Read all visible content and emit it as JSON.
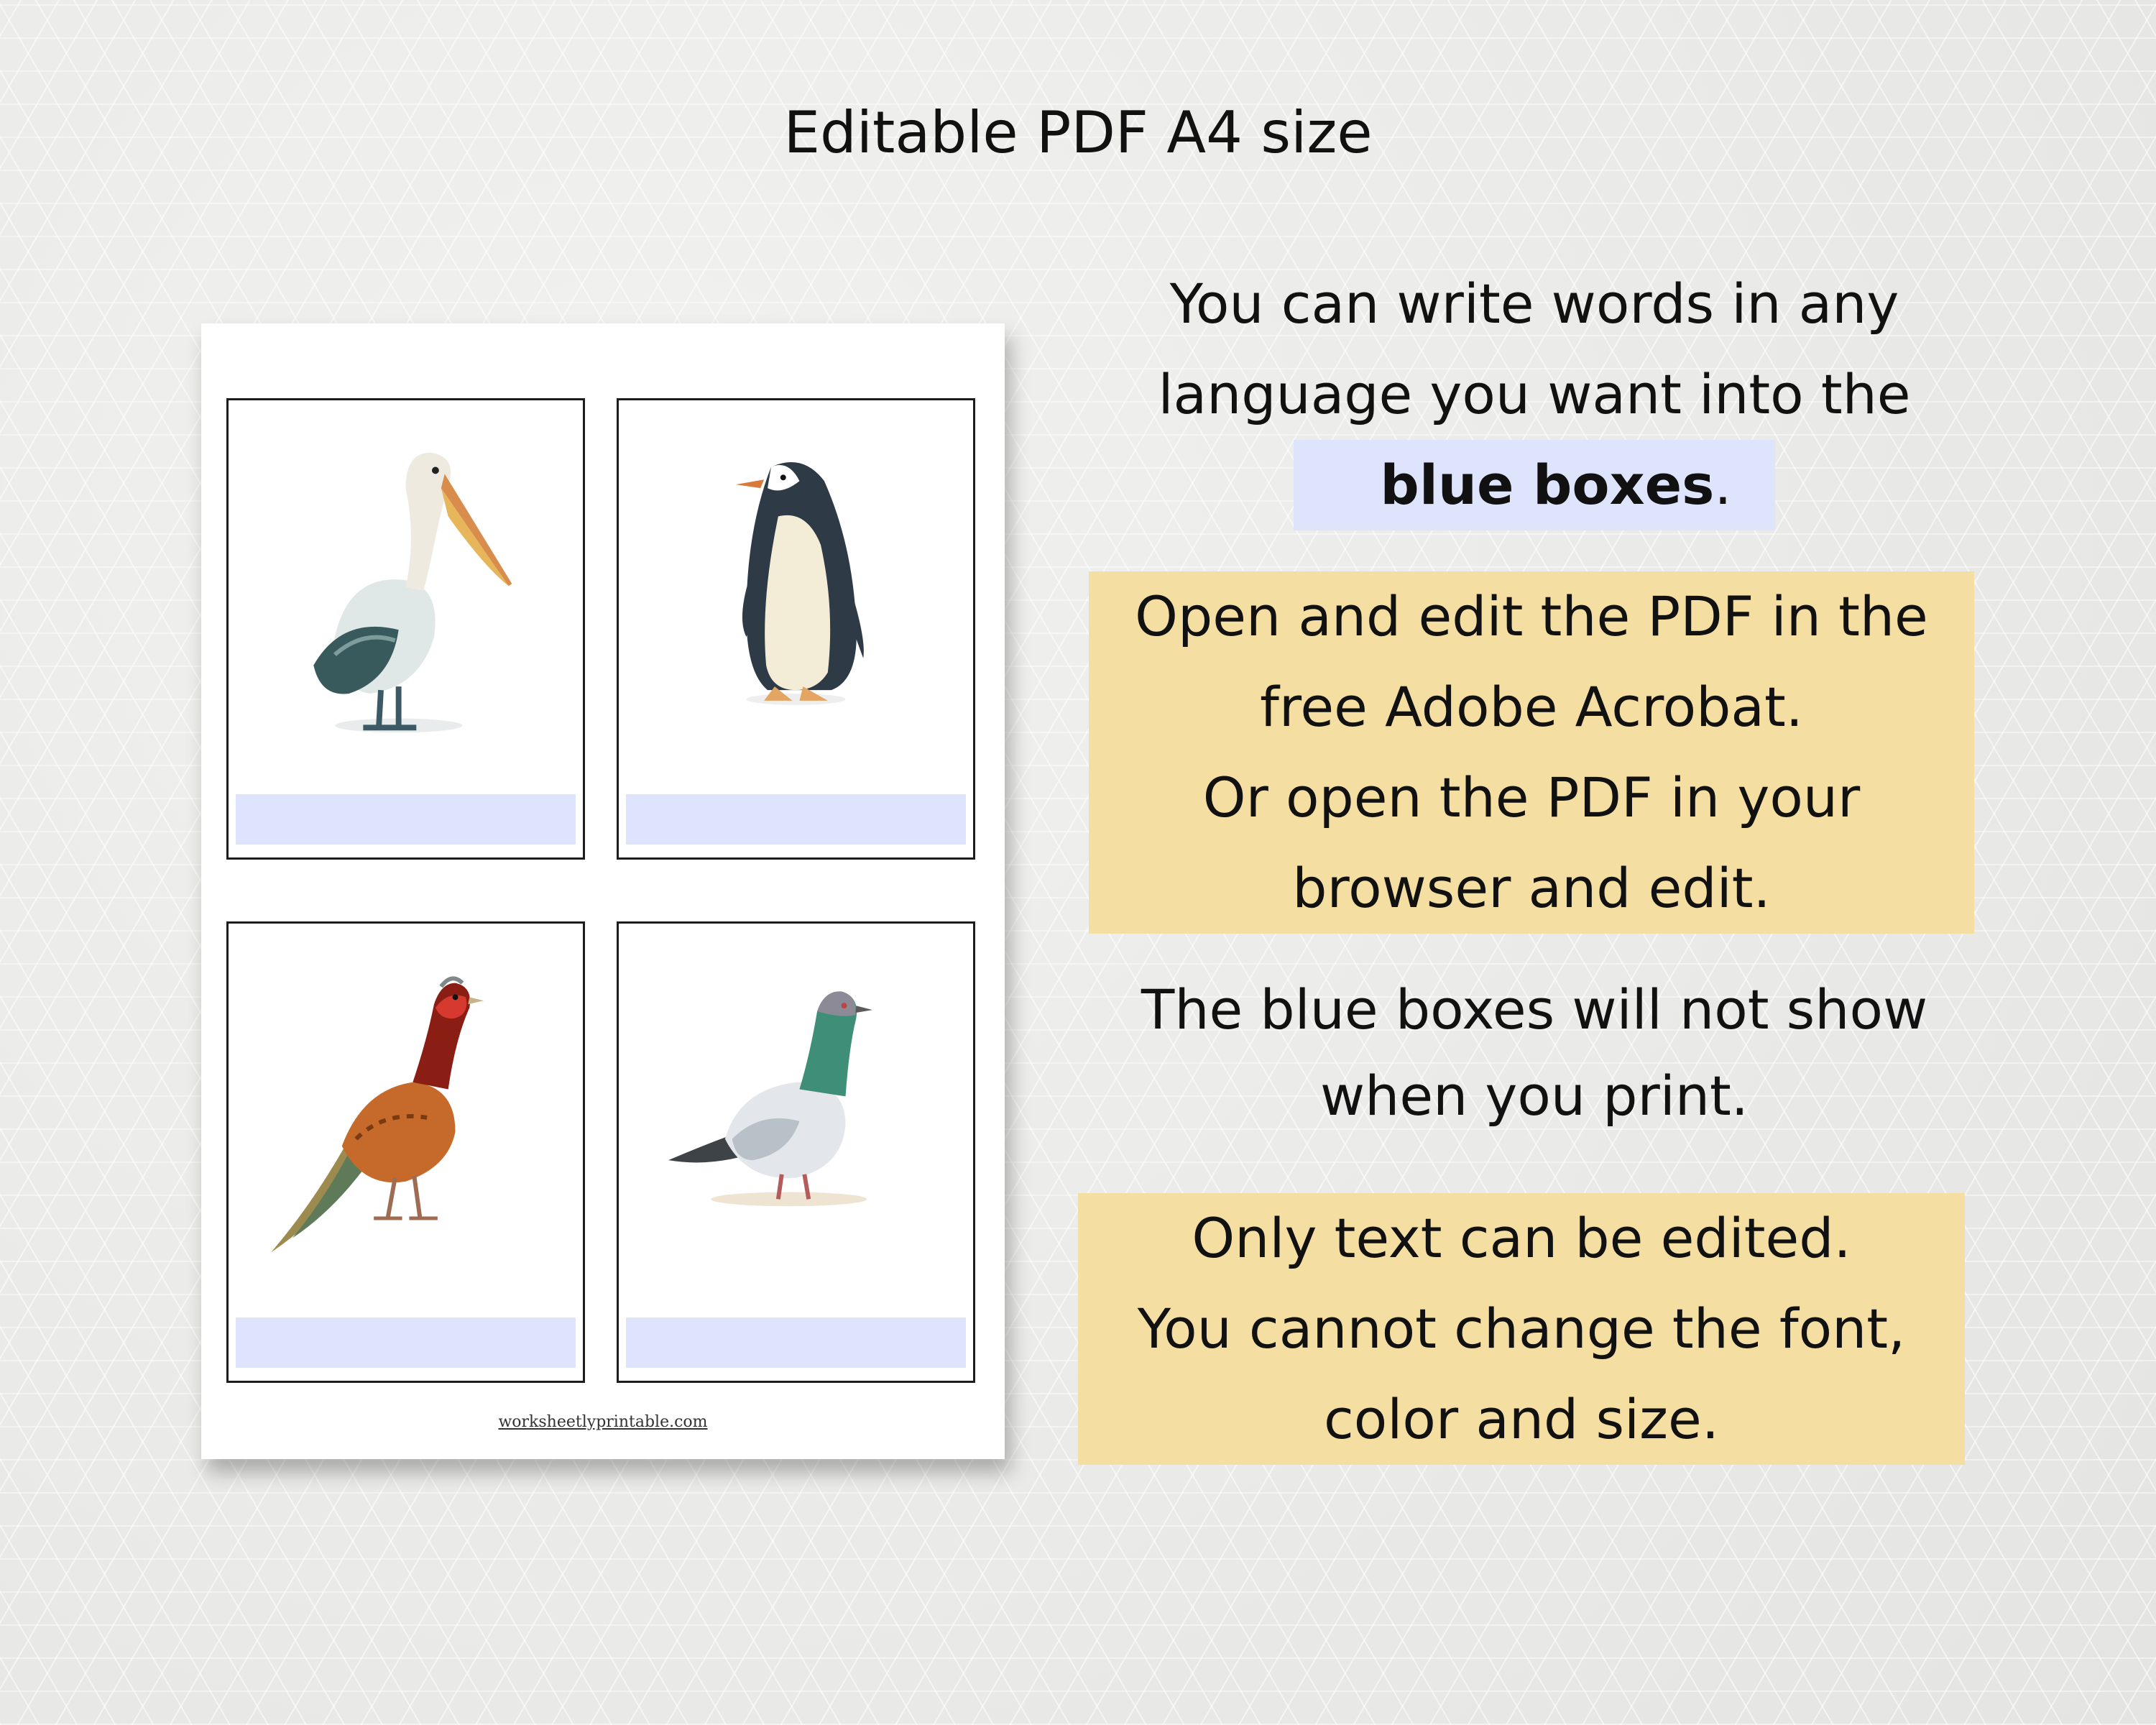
{
  "title": "Editable PDF A4 size",
  "sheet": {
    "cards": [
      {
        "animal": "pelican-illustration"
      },
      {
        "animal": "penguin-illustration"
      },
      {
        "animal": "pheasant-illustration"
      },
      {
        "animal": "pigeon-illustration"
      }
    ],
    "footer": "worksheetlyprintable.com"
  },
  "info": {
    "block1_line1": "You can write words in any",
    "block1_line2": "language you want into the",
    "block1_bold": "blue boxes",
    "block1_period": ".",
    "block2_line1": "Open and edit the PDF in the",
    "block2_line2": "free Adobe Acrobat.",
    "block2_line3": "Or open the PDF in your",
    "block2_line4": "browser and edit.",
    "block3_line1": "The blue boxes will not show",
    "block3_line2": "when you print.",
    "block4_line1": "Only text can be edited.",
    "block4_line2": "You cannot change the font,",
    "block4_line3": "color and size."
  },
  "colors": {
    "yellow_highlight": "#f4dea1",
    "blue_box": "#dde4fb"
  }
}
